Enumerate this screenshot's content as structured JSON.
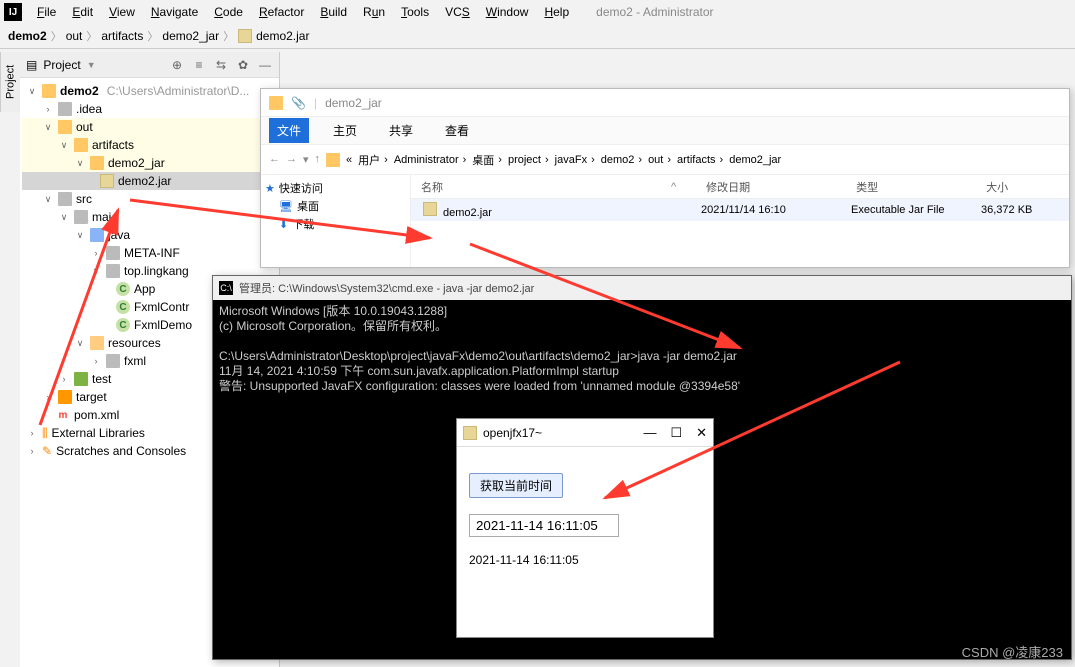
{
  "ide": {
    "menus": [
      "File",
      "Edit",
      "View",
      "Navigate",
      "Code",
      "Refactor",
      "Build",
      "Run",
      "Tools",
      "VCS",
      "Window",
      "Help"
    ],
    "title_suffix": "demo2 - Administrator",
    "breadcrumbs": [
      "demo2",
      "out",
      "artifacts",
      "demo2_jar",
      "demo2.jar"
    ],
    "project_label": "Project"
  },
  "tree": {
    "root": {
      "name": "demo2",
      "path": "C:\\Users\\Administrator\\D..."
    },
    "idea": ".idea",
    "out": "out",
    "artifacts": "artifacts",
    "demo2_jar_dir": "demo2_jar",
    "demo2_jar_file": "demo2.jar",
    "src": "src",
    "mai": "mai",
    "java": "java",
    "metainf": "META-INF",
    "toplingkang": "top.lingkang",
    "app": "App",
    "fxmlcontr": "FxmlContr",
    "fxmldemo": "FxmlDemo",
    "resources": "resources",
    "fxml": "fxml",
    "test": "test",
    "target": "target",
    "pom": "pom.xml",
    "extlib": "External Libraries",
    "scratches": "Scratches and Consoles"
  },
  "explorer": {
    "title": "demo2_jar",
    "tabs": {
      "file": "文件",
      "home": "主页",
      "share": "共享",
      "view": "查看"
    },
    "path_root": "«",
    "path": [
      "用户",
      "Administrator",
      "桌面",
      "project",
      "javaFx",
      "demo2",
      "out",
      "artifacts",
      "demo2_jar"
    ],
    "side": {
      "quick": "快速访问",
      "desktop": "桌面",
      "download": "下载"
    },
    "cols": {
      "name": "名称",
      "date": "修改日期",
      "type": "类型",
      "size": "大小"
    },
    "row": {
      "name": "demo2.jar",
      "date": "2021/11/14 16:10",
      "type": "Executable Jar File",
      "size": "36,372 KB"
    }
  },
  "cmd": {
    "title": "管理员: C:\\Windows\\System32\\cmd.exe - java  -jar demo2.jar",
    "l1": "Microsoft Windows [版本 10.0.19043.1288]",
    "l2": "(c) Microsoft Corporation。保留所有权利。",
    "l3": "C:\\Users\\Administrator\\Desktop\\project\\javaFx\\demo2\\out\\artifacts\\demo2_jar>java -jar demo2.jar",
    "l4": "11月 14, 2021 4:10:59 下午 com.sun.javafx.application.PlatformImpl startup",
    "l5": "警告: Unsupported JavaFX configuration: classes were loaded from 'unnamed module @3394e58'"
  },
  "fxapp": {
    "title": "openjfx17~",
    "btn": "获取当前时间",
    "input": "2021-11-14 16:11:05",
    "label": "2021-11-14 16:11:05"
  },
  "watermark": "CSDN @凌康233",
  "colors": {
    "arrow": "#ff3b30"
  }
}
